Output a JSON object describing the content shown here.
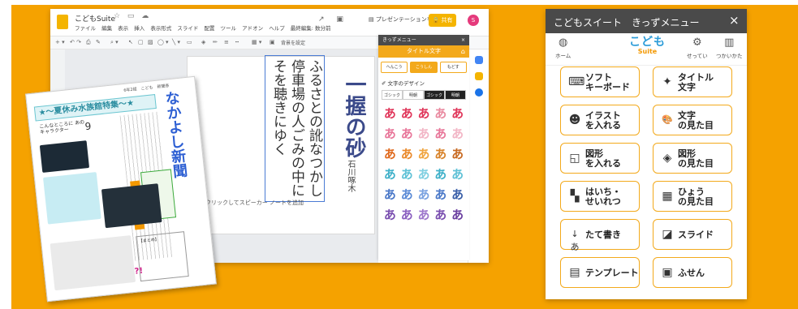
{
  "app": {
    "doc_title": "こどもSuite",
    "menu": [
      "ファイル",
      "編集",
      "表示",
      "挿入",
      "表示形式",
      "スライド",
      "配置",
      "ツール",
      "アドオン",
      "ヘルプ",
      "最終編集: 数分前"
    ],
    "present_label": "プレゼンテーションを開始",
    "share_label": "共有",
    "avatar_initial": "S",
    "toolbar_bg_label": "背景を設定"
  },
  "slide": {
    "poem_lines": [
      "ふるさとの訛なつかし",
      "停車場の人ごみの中に",
      "そを聴きにゆく"
    ],
    "title": "一握の砂",
    "author": "石川啄木",
    "notes_placeholder": "ここをクリックしてスピーカー ノートを追加"
  },
  "inner_panel": {
    "header": "きっずメニュー",
    "subheader": "タイトル文字",
    "chips": [
      "へんこう",
      "こうしん",
      "もどす"
    ],
    "section_label": "文字のデザイン",
    "font_tabs": [
      "ゴシック",
      "明朝",
      "ゴシック",
      "明朝"
    ],
    "glyph": "あ",
    "glyph_colors": [
      "#e0365a",
      "#e0365a",
      "#e0365a",
      "#e98aa0",
      "#e0365a",
      "#e8779a",
      "#e8779a",
      "#f2b6c6",
      "#e8779a",
      "#f2b6c6",
      "#e06a1e",
      "#ea8a2c",
      "#f0a540",
      "#d8832a",
      "#c86a22",
      "#3fb0c9",
      "#5fc1d6",
      "#7fcfe1",
      "#3fb0c9",
      "#5fc1d6",
      "#4a78c8",
      "#5a8ad6",
      "#7aa2e0",
      "#4a78c8",
      "#3a5fa8",
      "#7a4fb0",
      "#8a5fc0",
      "#9d77cc",
      "#7a4fb0",
      "#6a3fa0"
    ]
  },
  "newspaper": {
    "banner": "〜夏休み水族館特集〜",
    "name": "なかよし新聞",
    "top_meta": "6年2組　こども　新聞係",
    "subtitle": "こんなところに あのキャラクター",
    "number": "9",
    "note_title": "【まとめ】",
    "qa": "?!"
  },
  "menu_panel": {
    "title": "こどもスイート　きっずメニュー",
    "close_glyph": "×",
    "nav": {
      "home": {
        "icon": "home-icon",
        "label": "ホーム"
      },
      "logo_main": "こども",
      "logo_sub": "Suite",
      "settings": {
        "icon": "gear-icon",
        "label": "せってい"
      },
      "help": {
        "icon": "book-icon",
        "label": "つかいかた"
      }
    },
    "buttons": [
      {
        "label": "ソフト\nキーボード",
        "icon": "keyboard-icon",
        "glyph": "⌨"
      },
      {
        "label": "タイトル\n文字",
        "icon": "sparkle-icon",
        "glyph": "✦"
      },
      {
        "label": "イラスト\nを入れる",
        "icon": "smiley-icon",
        "glyph": "☻"
      },
      {
        "label": "文字\nの見た目",
        "icon": "palette-icon",
        "glyph": "🎨"
      },
      {
        "label": "図形\nを入れる",
        "icon": "shapes-icon",
        "glyph": "◱"
      },
      {
        "label": "図形\nの見た目",
        "icon": "paint-bucket-icon",
        "glyph": "◈"
      },
      {
        "label": "はいち・\nせいれつ",
        "icon": "arrange-icon",
        "glyph": "▚"
      },
      {
        "label": "ひょう\nの見た目",
        "icon": "table-icon",
        "glyph": "▦"
      },
      {
        "label": "たて書き",
        "icon": "vertical-text-icon",
        "glyph": "↓あ"
      },
      {
        "label": "スライド",
        "icon": "slide-icon",
        "glyph": "◪"
      },
      {
        "label": "テンプレート",
        "icon": "template-icon",
        "glyph": "▤"
      },
      {
        "label": "ふせん",
        "icon": "sticky-note-icon",
        "glyph": "▣"
      }
    ]
  }
}
